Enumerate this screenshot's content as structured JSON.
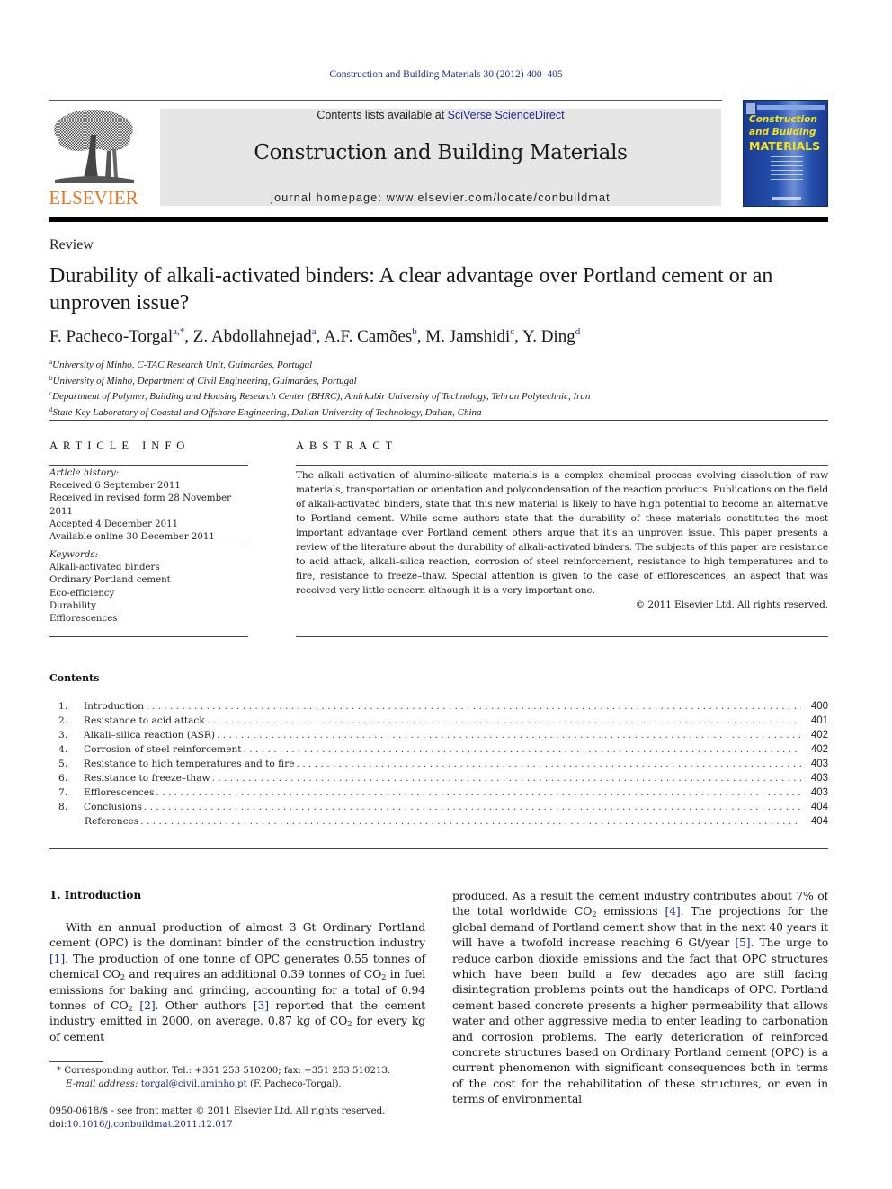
{
  "citation": "Construction and Building Materials 30 (2012) 400–405",
  "masthead": {
    "publisher_wordmark": "ELSEVIER",
    "contents_prefix": "Contents lists available at ",
    "contents_link": "SciVerse ScienceDirect",
    "journal_title": "Construction and Building Materials",
    "homepage_prefix": "journal homepage: ",
    "homepage_url": "www.elsevier.com/locate/conbuildmat",
    "cover": {
      "title_line1": "Construction",
      "title_line2": "and Building",
      "title_line3": "MATERIALS"
    },
    "colors": {
      "elsevier_orange": "#e87722",
      "link_blue": "#1f2a8a",
      "cover_blue": "#2452b0",
      "cover_yellow": "#f6e319",
      "banner_gray": "#e6e6e6"
    }
  },
  "article": {
    "type": "Review",
    "title": "Durability of alkali-activated binders: A clear advantage over Portland cement or an unproven issue?",
    "authors": [
      {
        "name": "F. Pacheco-Torgal",
        "sup": "a,*",
        "sep": ", "
      },
      {
        "name": "Z. Abdollahnejad",
        "sup": "a",
        "sep": ", "
      },
      {
        "name": "A.F. Camões",
        "sup": "b",
        "sep": ", "
      },
      {
        "name": "M. Jamshidi",
        "sup": "c",
        "sep": ", "
      },
      {
        "name": "Y. Ding",
        "sup": "d",
        "sep": ""
      }
    ],
    "affiliations": [
      {
        "key": "a",
        "text": "University of Minho, C-TAC Research Unit, Guimarães, Portugal"
      },
      {
        "key": "b",
        "text": "University of Minho, Department of Civil Engineering, Guimarães, Portugal"
      },
      {
        "key": "c",
        "text": "Department of Polymer, Building and Housing Research Center (BHRC), Amirkabir University of Technology, Tehran Polytechnic, Iran"
      },
      {
        "key": "d",
        "text": "State Key Laboratory of Coastal and Offshore Engineering, Dalian University of Technology, Dalian, China"
      }
    ]
  },
  "article_info": {
    "heading": "ARTICLE INFO",
    "history_label": "Article history:",
    "history": [
      "Received 6 September 2011",
      "Received in revised form 28 November 2011",
      "Accepted 4 December 2011",
      "Available online 30 December 2011"
    ],
    "keywords_label": "Keywords:",
    "keywords": [
      "Alkali-activated binders",
      "Ordinary Portland cement",
      "Eco-efficiency",
      "Durability",
      "Efflorescences"
    ]
  },
  "abstract": {
    "heading": "ABSTRACT",
    "text": "The alkali activation of alumino-silicate materials is a complex chemical process evolving dissolution of raw materials, transportation or orientation and polycondensation of the reaction products. Publications on the field of alkali-activated binders, state that this new material is likely to have high potential to become an alternative to Portland cement. While some authors state that the durability of these materials constitutes the most important advantage over Portland cement others argue that it's an unproven issue. This paper presents a review of the literature about the durability of alkali-activated binders. The subjects of this paper are resistance to acid attack, alkali–silica reaction, corrosion of steel reinforcement, resistance to high temperatures and to fire, resistance to freeze–thaw. Special attention is given to the case of efflorescences, an aspect that was received very little concern although it is a very important one.",
    "copyright": "© 2011 Elsevier Ltd. All rights reserved."
  },
  "contents": {
    "heading": "Contents",
    "items": [
      {
        "num": "1.",
        "title": "Introduction",
        "page": "400"
      },
      {
        "num": "2.",
        "title": "Resistance to acid attack",
        "page": "401"
      },
      {
        "num": "3.",
        "title": "Alkali–silica reaction (ASR)",
        "page": "402"
      },
      {
        "num": "4.",
        "title": "Corrosion of steel reinforcement",
        "page": "402"
      },
      {
        "num": "5.",
        "title": "Resistance to high temperatures and to fire",
        "page": "403"
      },
      {
        "num": "6.",
        "title": "Resistance to freeze–thaw",
        "page": "403"
      },
      {
        "num": "7.",
        "title": "Efflorescences",
        "page": "403"
      },
      {
        "num": "8.",
        "title": "Conclusions",
        "page": "404"
      },
      {
        "num": "",
        "title": "References",
        "page": "404"
      }
    ]
  },
  "introduction": {
    "heading": "1. Introduction",
    "left_column": [
      {
        "t": "With an annual production of almost 3 Gt Ordinary Portland cement (OPC) is the dominant binder of the construction industry "
      },
      {
        "ref": "[1]"
      },
      {
        "t": ". The production of one tonne of OPC generates 0.55 tonnes of chemical CO"
      },
      {
        "sub": "2"
      },
      {
        "t": " and requires an additional 0.39 tonnes of CO"
      },
      {
        "sub": "2"
      },
      {
        "t": " in fuel emissions for baking and grinding, accounting for a total of 0.94 tonnes of CO"
      },
      {
        "sub": "2"
      },
      {
        "t": " "
      },
      {
        "ref": "[2]"
      },
      {
        "t": ". Other authors "
      },
      {
        "ref": "[3]"
      },
      {
        "t": " reported that the cement industry emitted in 2000, on average, 0.87 kg of CO"
      },
      {
        "sub": "2"
      },
      {
        "t": " for every kg of cement"
      }
    ],
    "right_column": [
      {
        "t": "produced. As a result the cement industry contributes about 7% of the total worldwide CO"
      },
      {
        "sub": "2"
      },
      {
        "t": " emissions "
      },
      {
        "ref": "[4]"
      },
      {
        "t": ". The projections for the global demand of Portland cement show that in the next 40 years it will have a twofold increase reaching 6 Gt/year "
      },
      {
        "ref": "[5]"
      },
      {
        "t": ". The urge to reduce carbon dioxide emissions and the fact that OPC structures which have been build a few decades ago are still facing disintegration problems points out the handicaps of OPC. Portland cement based concrete presents a higher permeability that allows water and other aggressive media to enter leading to carbonation and corrosion problems. The early deterioration of reinforced concrete structures based on Ordinary Portland cement (OPC) is a current phenomenon with significant consequences both in terms of the cost for the rehabilitation of these structures, or even in terms of environmental"
      }
    ]
  },
  "footnote": {
    "marker": "*",
    "corresponding": "Corresponding author. Tel.: +351 253 510200; fax: +351 253 510213.",
    "email_label": "E-mail address:",
    "email": "torgal@civil.uminho.pt",
    "email_suffix": " (F. Pacheco-Torgal)."
  },
  "front_matter": {
    "issn_line": "0950-0618/$ - see front matter © 2011 Elsevier Ltd. All rights reserved.",
    "doi_prefix": "doi:",
    "doi": "10.1016/j.conbuildmat.2011.12.017"
  }
}
